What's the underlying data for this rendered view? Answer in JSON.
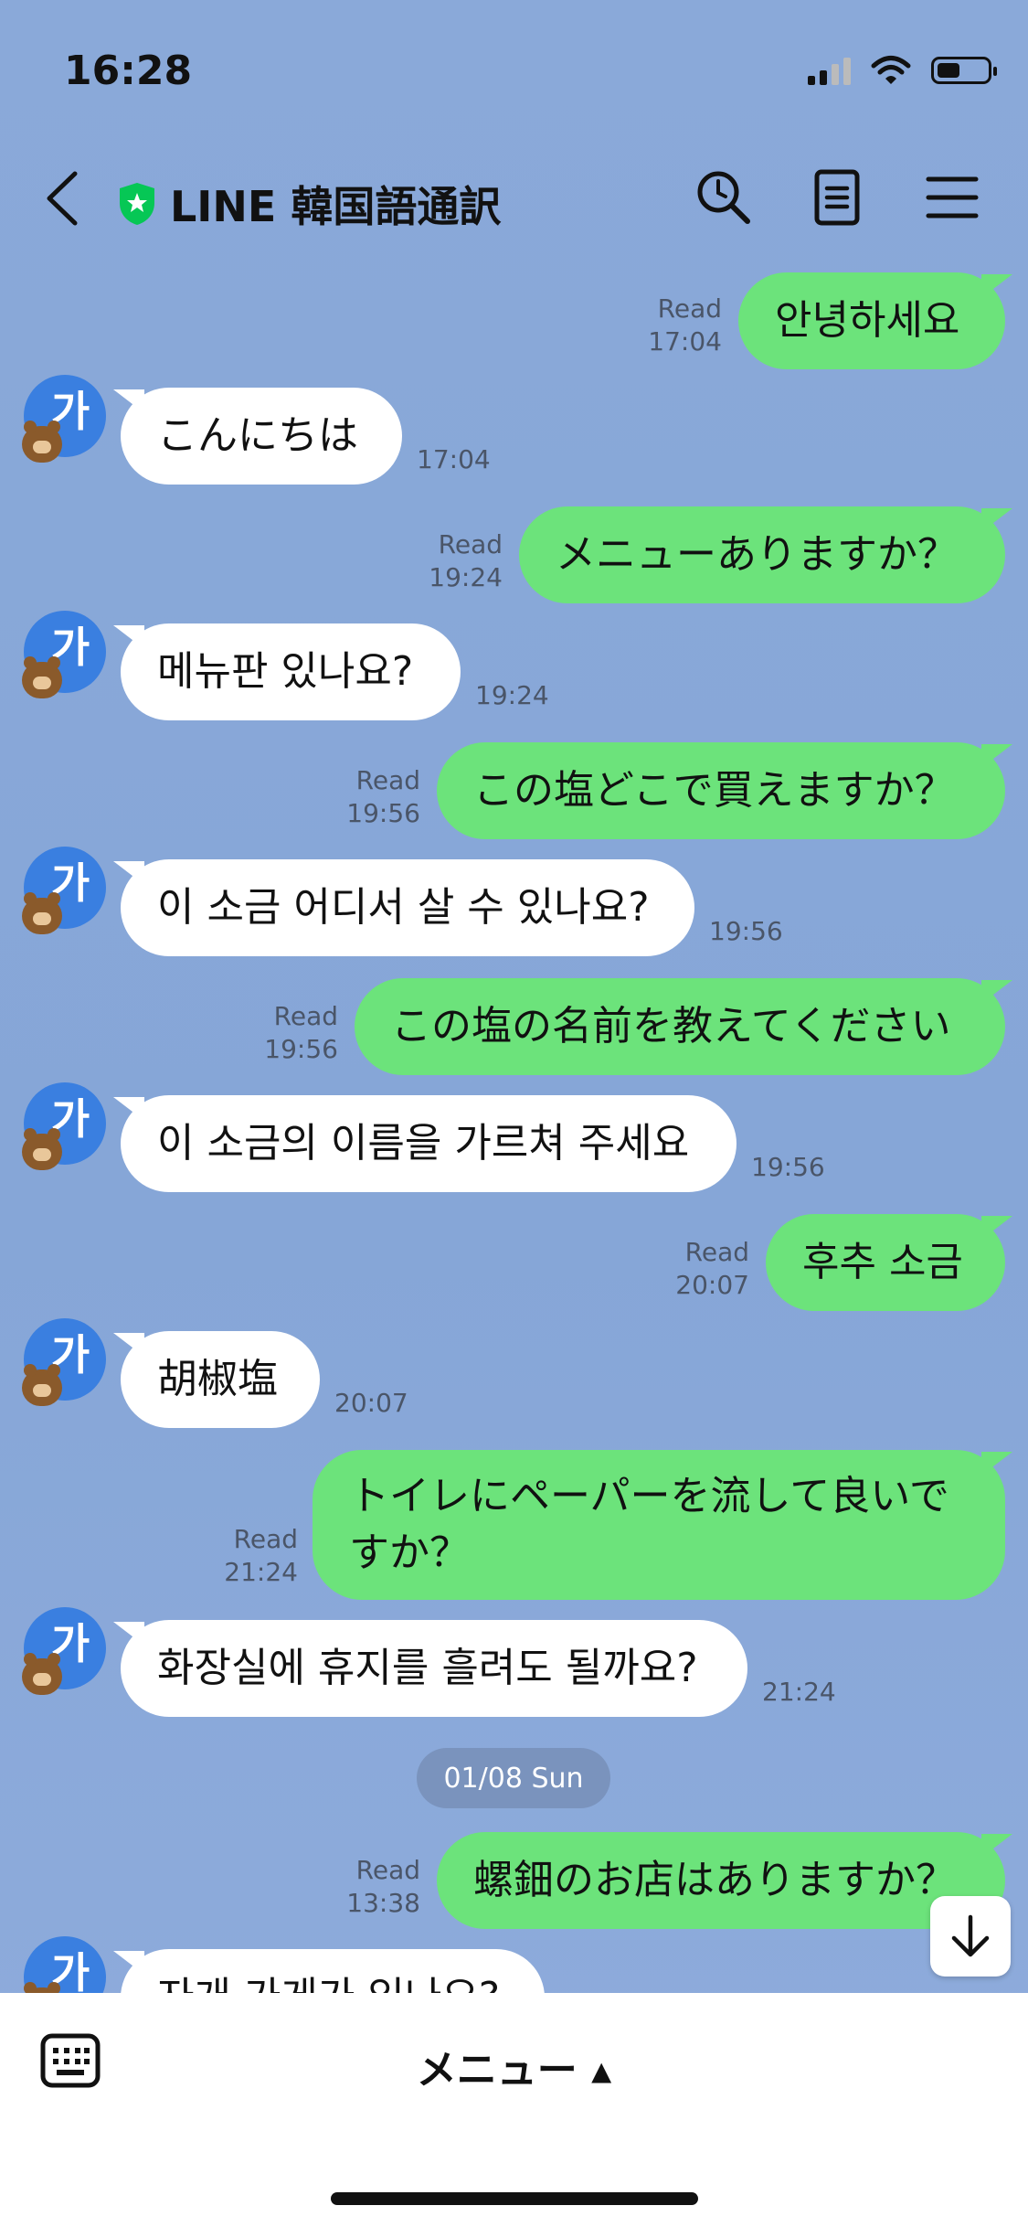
{
  "status_bar": {
    "time": "16:28"
  },
  "header": {
    "title": "LINE 韓国語通訳"
  },
  "messages": [
    {
      "dir": "out",
      "text": "안녕하세요",
      "read": "Read",
      "time": "17:04"
    },
    {
      "dir": "in",
      "avatar": "가",
      "text": "こんにちは",
      "time": "17:04"
    },
    {
      "dir": "out",
      "text": "メニューありますか？",
      "read": "Read",
      "time": "19:24"
    },
    {
      "dir": "in",
      "avatar": "가",
      "text": "메뉴판 있나요?",
      "time": "19:24"
    },
    {
      "dir": "out",
      "text": "この塩どこで買えますか？",
      "read": "Read",
      "time": "19:56"
    },
    {
      "dir": "in",
      "avatar": "가",
      "text": "이 소금 어디서 살 수 있나요?",
      "time": "19:56"
    },
    {
      "dir": "out",
      "text": "この塩の名前を教えてください",
      "read": "Read",
      "time": "19:56"
    },
    {
      "dir": "in",
      "avatar": "가",
      "text": "이 소금의 이름을 가르쳐 주세요",
      "time": "19:56"
    },
    {
      "dir": "out",
      "text": "후추 소금",
      "read": "Read",
      "time": "20:07"
    },
    {
      "dir": "in",
      "avatar": "가",
      "text": "胡椒塩",
      "time": "20:07"
    },
    {
      "dir": "out",
      "text": "トイレにペーパーを流して良いですか？",
      "read": "Read",
      "time": "21:24"
    },
    {
      "dir": "in",
      "avatar": "가",
      "text": "화장실에 휴지를 흘려도 될까요?",
      "time": "21:24"
    },
    {
      "dir": "out",
      "text": "螺鈿のお店はありますか？",
      "read": "Read",
      "time": "13:38"
    },
    {
      "dir": "in",
      "avatar": "가",
      "text": "자개 가게가 있나요?",
      "time": ""
    }
  ],
  "date_divider": "01/08 Sun",
  "bottom_bar": {
    "menu_label": "メニュー ▴"
  },
  "colors": {
    "outgoing_bubble": "#6ce37b",
    "incoming_bubble": "#ffffff",
    "background": "#8aa9d9",
    "avatar": "#3a7fe0"
  },
  "icons": [
    "back-arrow-icon",
    "shield-icon",
    "search-icon",
    "notes-icon",
    "menu-icon",
    "arrow-down-icon",
    "keyboard-icon"
  ]
}
